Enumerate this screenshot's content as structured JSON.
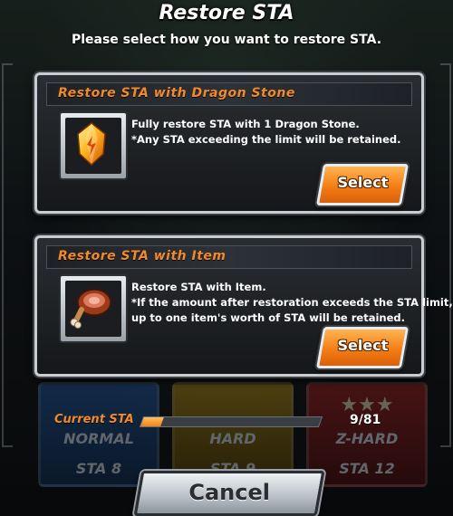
{
  "dialog": {
    "title": "Restore STA",
    "subtitle": "Please select how you want to restore STA."
  },
  "options": [
    {
      "header": "Restore STA with Dragon Stone",
      "icon": "dragon-stone-icon",
      "lines": [
        "Fully restore STA with 1 Dragon Stone.",
        "*Any STA exceeding the limit will be retained."
      ],
      "button_label": "Select"
    },
    {
      "header": "Restore STA with Item",
      "icon": "meat-item-icon",
      "lines": [
        "Restore STA with Item.",
        "*If the amount after restoration exceeds the STA limit,",
        "up to one item's worth of STA will be retained."
      ],
      "button_label": "Select"
    }
  ],
  "background": {
    "difficulties": [
      {
        "label": "NORMAL",
        "sta": "STA  8"
      },
      {
        "label": "HARD",
        "sta": "STA  9"
      },
      {
        "label": "Z-HARD",
        "sta": "STA 12"
      }
    ]
  },
  "sta": {
    "label": "Current STA",
    "value_text": "9/81",
    "current": 9,
    "max": 81
  },
  "cancel_label": "Cancel",
  "colors": {
    "header_orange": "#f28a2a",
    "button_orange": "#f57e14",
    "panel_dark": "#15171a"
  }
}
